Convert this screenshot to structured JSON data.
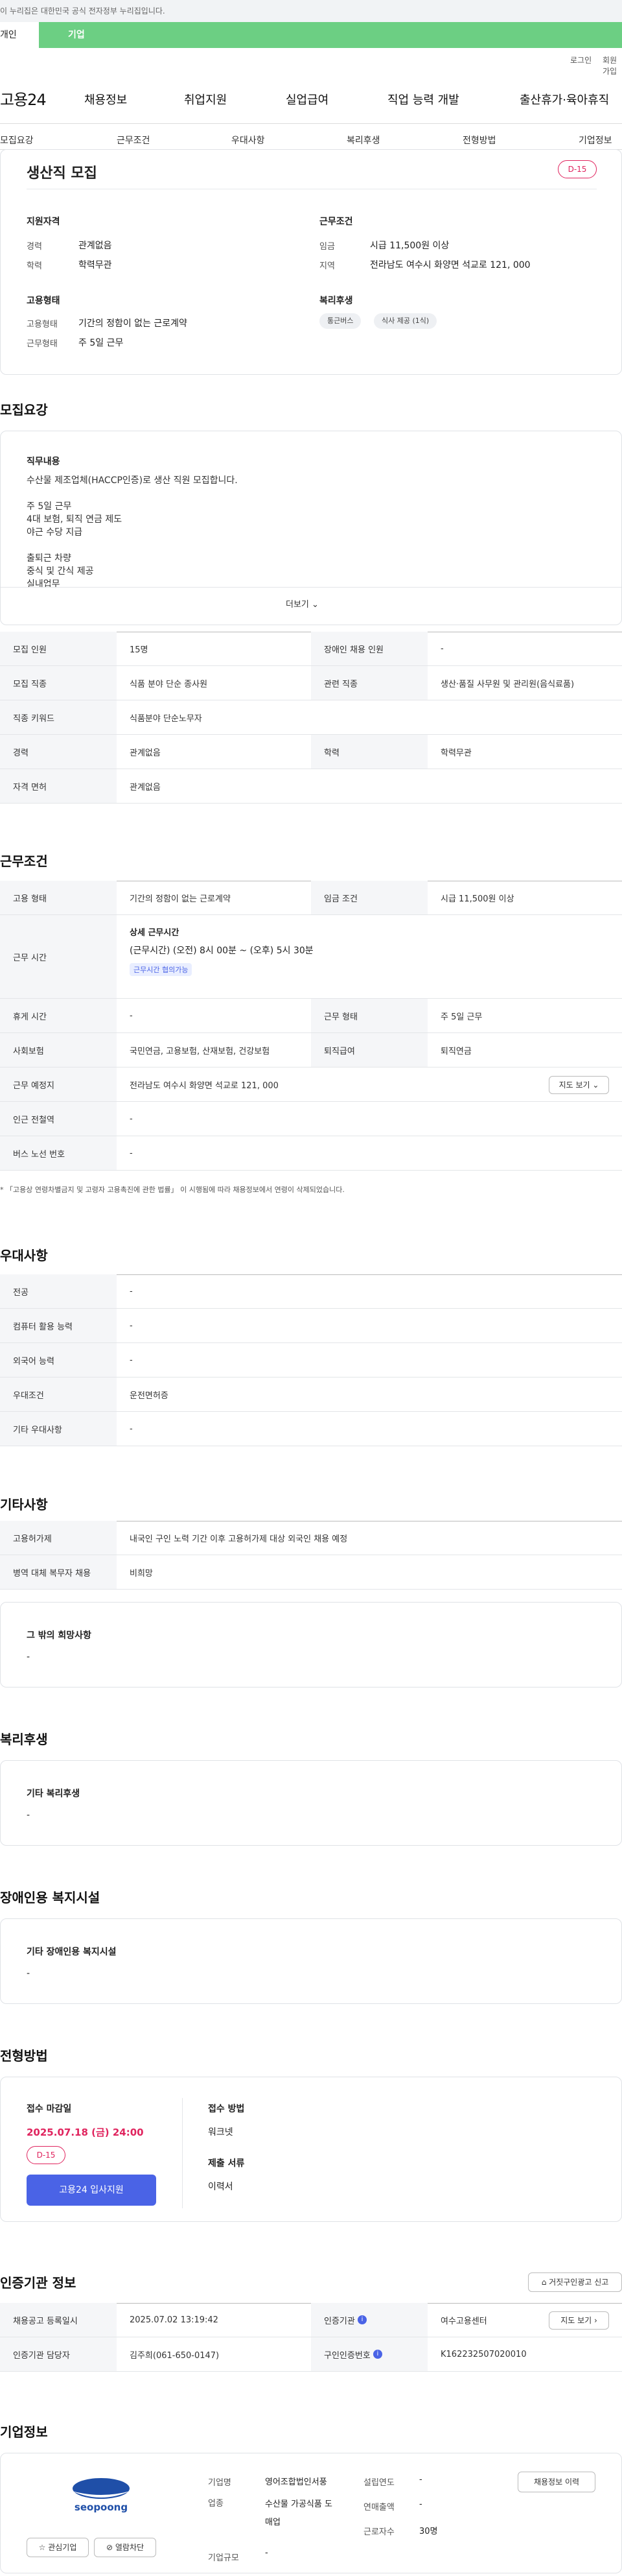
{
  "gov_notice": "이 누리집은 대한민국 공식 전자정부 누리집입니다.",
  "top_tabs": [
    "개인",
    "기업"
  ],
  "util_links": [
    "로그인",
    "회원가입"
  ],
  "logo": "고용24",
  "gnb": [
    "채용정보",
    "취업지원",
    "실업급여",
    "직업 능력 개발",
    "출산휴가·육아휴직"
  ],
  "subnav": [
    "모집요강",
    "근무조건",
    "우대사항",
    "복리후생",
    "전형방법",
    "기업정보"
  ],
  "summary": {
    "title": "생산직 모집",
    "dday": "D-15",
    "qual_heading": "지원자격",
    "qual": [
      [
        "경력",
        "관계없음"
      ],
      [
        "학력",
        "학력무관"
      ]
    ],
    "work_heading": "근무조건",
    "work": [
      [
        "임금",
        "시급 11,500원 이상"
      ],
      [
        "지역",
        "전라남도 여수시 화양면 석교로 121, 000"
      ]
    ],
    "emp_heading": "고용형태",
    "emp": [
      [
        "고용형태",
        "기간의 정함이 없는 근로계약"
      ],
      [
        "근무형태",
        "주 5일 근무"
      ]
    ],
    "welfare_heading": "복리후생",
    "welfare_chips": [
      "통근버스",
      "식사 제공 (1식)"
    ]
  },
  "recruit": {
    "heading": "모집요강",
    "duty_heading": "직무내용",
    "lines": [
      "수산물 제조업체(HACCP인증)로 생산 직원 모집합니다.",
      "",
      "주 5일 근무",
      "4대 보험, 퇴직 연금 제도",
      "야근 수당 지급",
      "",
      "출퇴근 차량",
      "중식 및 간식 제공",
      "실내업무"
    ],
    "more": "더보기"
  },
  "recruit_table": [
    [
      [
        "모집 인원",
        "15명"
      ],
      [
        "장애인 채용 인원",
        "-"
      ]
    ],
    [
      [
        "모집 직종",
        "식품 분야 단순 종사원"
      ],
      [
        "관련 직종",
        "생산·품질 사무원 및 관리원(음식료품)"
      ]
    ],
    [
      [
        "직종 키워드",
        "식품분야 단순노무자"
      ]
    ],
    [
      [
        "경력",
        "관계없음"
      ],
      [
        "학력",
        "학력무관"
      ]
    ],
    [
      [
        "자격 면허",
        "관계없음"
      ]
    ]
  ],
  "work_cond": {
    "heading": "근무조건",
    "emp_type_label": "고용 형태",
    "emp_type": "기간의 정함이 없는 근로계약",
    "wage_label": "임금 조건",
    "wage": "시급 11,500원 이상",
    "hours_label": "근무 시간",
    "hours_title": "상세 근무시간",
    "hours_detail": "(근무시간) (오전) 8시 00분 ~ (오후) 5시 30분",
    "hours_tag": "근무시간 협의가능",
    "rows": [
      [
        [
          "휴게 시간",
          "-"
        ],
        [
          "근무 형태",
          "주 5일 근무"
        ]
      ],
      [
        [
          "사회보험",
          "국민연금, 고용보험, 산재보험, 건강보험"
        ],
        [
          "퇴직급여",
          "퇴직연금"
        ]
      ]
    ],
    "place_label": "근무 예정지",
    "place": "전라남도 여수시 화양면 석교로 121, 000",
    "map_btn": "지도 보기",
    "station_label": "인근 전철역",
    "station": "-",
    "bus_label": "버스 노선 번호",
    "bus": "-",
    "note": "* 「고용상 연령차별금지 및 고령자 고용촉진에 관한 법률」 이 시행됨에 따라 채용정보에서 연령이 삭제되었습니다."
  },
  "pref": {
    "heading": "우대사항",
    "rows": [
      [
        "전공",
        "-"
      ],
      [
        "컴퓨터 활용 능력",
        "-"
      ],
      [
        "외국어 능력",
        "-"
      ],
      [
        "우대조건",
        "운전면허증"
      ],
      [
        "기타 우대사항",
        "-"
      ]
    ]
  },
  "etc": {
    "heading": "기타사항",
    "rows": [
      [
        "고용허가제",
        "내국인 구인 노력 기간 이후 고용허가제 대상 외국인 채용 예정"
      ],
      [
        "병역 대체 복무자 채용",
        "비희망"
      ]
    ],
    "box_title": "그 밖의 희망사항",
    "box_val": "-"
  },
  "welfare": {
    "heading": "복리후생",
    "box_title": "기타 복리후생",
    "box_val": "-"
  },
  "disab": {
    "heading": "장애인용 복지시설",
    "box_title": "기타 장애인용 복지시설",
    "box_val": "-"
  },
  "screening": {
    "heading": "전형방법",
    "deadline_label": "접수 마감일",
    "deadline": "2025.07.18 (금) 24:00",
    "dday": "D-15",
    "apply_btn": "고용24 입사지원",
    "method_label": "접수 방법",
    "method": "워크넷",
    "docs_label": "제출 서류",
    "docs": "이력서"
  },
  "agency": {
    "heading": "인증기관 정보",
    "report_btn": "거짓구인광고 신고",
    "rows": [
      [
        [
          "채용공고 등록일시",
          "2025.07.02 13:19:42"
        ],
        [
          "인증기관",
          "여수고용센터"
        ]
      ],
      [
        [
          "인증기관 담당자",
          "김주희(061-650-0147)"
        ],
        [
          "구인인증번호",
          "K162232507020010"
        ]
      ]
    ],
    "map_btn": "지도 보기"
  },
  "company": {
    "heading": "기업정보",
    "logo_text": "seopoong",
    "fav_btn": "관심기업",
    "block_btn": "열람차단",
    "fields": [
      [
        "기업명",
        "영어조합법인서풍"
      ],
      [
        "업종",
        "수산물 가공식품 도매업"
      ],
      [
        "기업규모",
        "-"
      ]
    ],
    "fields2": [
      [
        "설립연도",
        "-"
      ],
      [
        "연매출액",
        "-"
      ],
      [
        "근로자수",
        "30명"
      ]
    ],
    "jobs_btn": "채용정보 이력"
  },
  "colors": {
    "accent": "#4a63e6",
    "green": "#6ccf83",
    "danger": "#e0245e"
  }
}
